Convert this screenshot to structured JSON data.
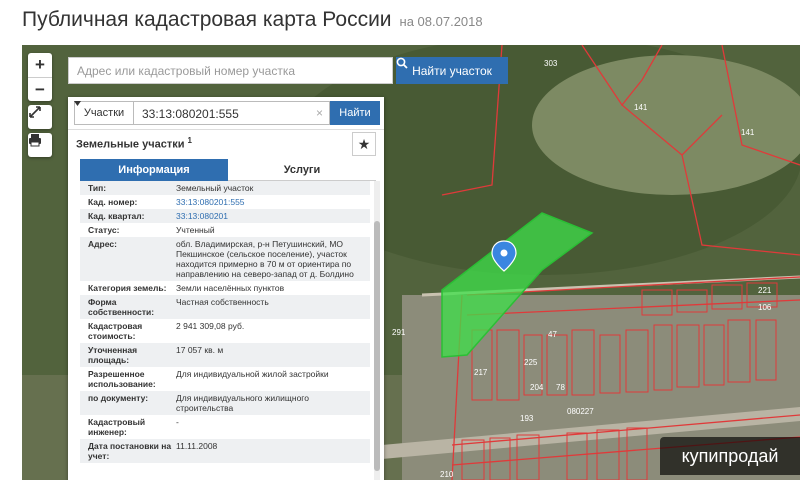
{
  "header": {
    "title": "Публичная кадастровая карта России",
    "date": "на 08.07.2018"
  },
  "map_controls": {
    "zoom_in": "+",
    "zoom_out": "−"
  },
  "search": {
    "placeholder": "Адрес или кадастровый номер участка",
    "button_label": "Найти участок"
  },
  "panel": {
    "type_select": "Участки",
    "query_value": "33:13:080201:555",
    "clear": "×",
    "find_label": "Найти",
    "section_title": "Земельные участки",
    "section_sup": "1",
    "tabs": [
      {
        "label": "Информация",
        "active": true
      },
      {
        "label": "Услуги",
        "active": false
      }
    ],
    "attributes": [
      {
        "label": "Тип:",
        "value": "Земельный участок",
        "link": false
      },
      {
        "label": "Кад. номер:",
        "value": "33:13:080201:555",
        "link": true
      },
      {
        "label": "Кад. квартал:",
        "value": "33:13:080201",
        "link": true
      },
      {
        "label": "Статус:",
        "value": "Учтенный",
        "link": false
      },
      {
        "label": "Адрес:",
        "value": "обл. Владимирская, р-н Петушинский, МО Пекшинское (сельское поселение), участок находится примерно в 70 м от ориентира по направлению на северо-запад от д. Болдино",
        "link": false
      },
      {
        "label": "Категория земель:",
        "value": "Земли населённых пунктов",
        "link": false
      },
      {
        "label": "Форма собственности:",
        "value": "Частная собственность",
        "link": false
      },
      {
        "label": "Кадастровая стоимость:",
        "value": "2 941 309,08 руб.",
        "link": false
      },
      {
        "label": "Уточненная площадь:",
        "value": "17 057 кв. м",
        "link": false
      },
      {
        "label": "Разрешенное использование:",
        "value": "Для индивидуальной жилой застройки",
        "link": false
      },
      {
        "label": "по документу:",
        "value": "Для индивидуального жилищного строительства",
        "link": false
      },
      {
        "label": "Кадастровый инженер:",
        "value": "-",
        "link": false
      },
      {
        "label": "Дата постановки на учет:",
        "value": "11.11.2008",
        "link": false
      }
    ]
  },
  "map_labels": [
    "303",
    "141",
    "141",
    "291",
    "221",
    "106",
    "193",
    "080227",
    "210",
    "217",
    "225",
    "204",
    "47",
    "78"
  ],
  "watermark": "купипродай",
  "colors": {
    "accent": "#2f6eb0",
    "parcel_fill": "#3ee04a",
    "boundary": "#e03a3a"
  }
}
